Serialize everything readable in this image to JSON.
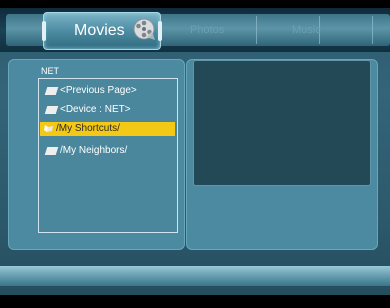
{
  "tabs": [
    {
      "label": "Movies",
      "active": true
    },
    {
      "label": "Photos",
      "active": false
    },
    {
      "label": "Music",
      "active": false
    }
  ],
  "panel": {
    "title": "NET",
    "items": [
      {
        "label": "<Previous Page>",
        "icon": "folder-icon",
        "selected": false
      },
      {
        "label": "<Device : NET>",
        "icon": "folder-icon",
        "selected": false
      },
      {
        "label": "/My  Shortcuts/",
        "icon": "folder-open-icon",
        "selected": true
      },
      {
        "label": "/My  Neighbors/",
        "icon": "folder-icon",
        "selected": false
      }
    ]
  },
  "colors": {
    "selection": "#f3c915",
    "background": "#336478",
    "panel": "#4b8aa0",
    "preview": "#234856"
  }
}
